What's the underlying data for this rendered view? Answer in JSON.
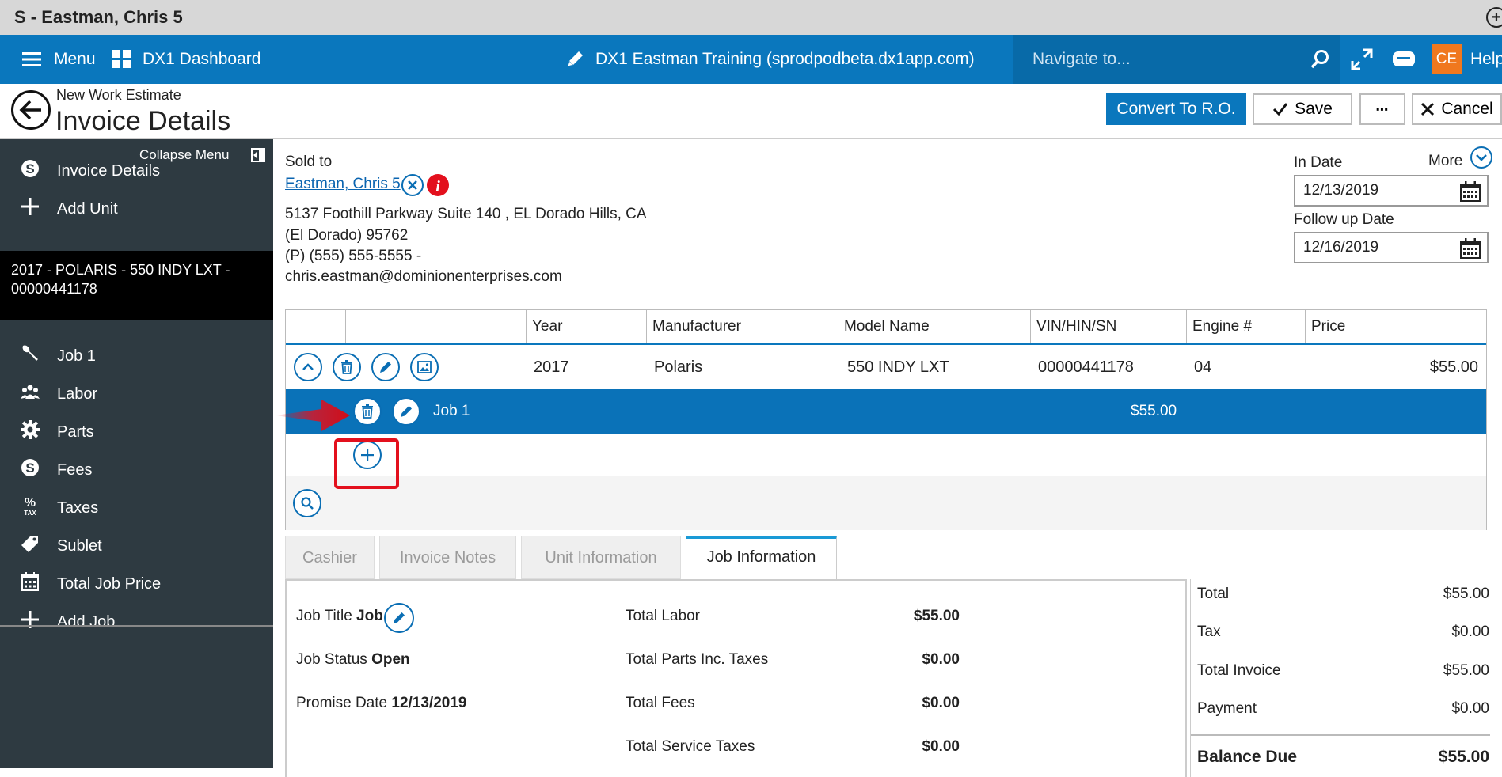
{
  "window": {
    "title": "S - Eastman, Chris 5"
  },
  "topbar": {
    "menu_label": "Menu",
    "dashboard_label": "DX1 Dashboard",
    "site_label": "DX1 Eastman Training (sprodpodbeta.dx1app.com)",
    "navigate_placeholder": "Navigate to...",
    "user_initials": "CE",
    "help_label": "Help",
    "bar_color": "#0a77bd"
  },
  "header": {
    "subtitle": "New Work Estimate",
    "title": "Invoice Details",
    "convert_label": "Convert To R.O.",
    "save_label": "Save",
    "more_label": "▪▪▪",
    "cancel_label": "Cancel"
  },
  "sidebar": {
    "collapse_label": "Collapse Menu",
    "top_items": [
      {
        "label": "Invoice Details",
        "icon": "dollar-circle-icon"
      },
      {
        "label": "Add Unit",
        "icon": "plus-icon"
      }
    ],
    "unit_label": "2017 - POLARIS - 550 INDY LXT - 00000441178",
    "items": [
      {
        "label": "Job 1",
        "icon": "wrench-icon"
      },
      {
        "label": "Labor",
        "icon": "people-icon"
      },
      {
        "label": "Parts",
        "icon": "gear-icon"
      },
      {
        "label": "Fees",
        "icon": "dollar-circle-icon"
      },
      {
        "label": "Taxes",
        "icon": "percent-tax-icon"
      },
      {
        "label": "Sublet",
        "icon": "tag-icon"
      },
      {
        "label": "Total Job Price",
        "icon": "calculator-icon"
      },
      {
        "label": "Add Job",
        "icon": "plus-icon"
      }
    ]
  },
  "customer": {
    "sold_to_label": "Sold to",
    "name": "Eastman, Chris 5",
    "address_line1": "5137 Foothill Parkway Suite 140 , EL Dorado Hills, CA",
    "address_line2": "(El Dorado) 95762",
    "phone": "(P) (555) 555-5555 -",
    "email": "chris.eastman@dominionenterprises.com"
  },
  "dates": {
    "more_label": "More",
    "in_date_label": "In Date",
    "in_date": "12/13/2019",
    "follow_up_label": "Follow up Date",
    "follow_up_date": "12/16/2019"
  },
  "unit_grid": {
    "headers": [
      "Year",
      "Manufacturer",
      "Model Name",
      "VIN/HIN/SN",
      "Engine #",
      "Price"
    ],
    "unit_row": {
      "year": "2017",
      "manufacturer": "Polaris",
      "model": "550 INDY LXT",
      "vin": "00000441178",
      "engine": "04",
      "price": "$55.00"
    },
    "job_row": {
      "name": "Job 1",
      "price": "$55.00"
    }
  },
  "tabs": [
    {
      "label": "Cashier",
      "active": false
    },
    {
      "label": "Invoice Notes",
      "active": false
    },
    {
      "label": "Unit Information",
      "active": false
    },
    {
      "label": "Job Information",
      "active": true
    }
  ],
  "job_info": {
    "title_label": "Job Title",
    "title_value": "Job 1",
    "status_label": "Job Status",
    "status_value": "Open",
    "promise_label": "Promise Date",
    "promise_value": "12/13/2019",
    "totals": [
      {
        "label": "Total Labor",
        "value": "$55.00"
      },
      {
        "label": "Total Parts Inc. Taxes",
        "value": "$0.00"
      },
      {
        "label": "Total Fees",
        "value": "$0.00"
      },
      {
        "label": "Total Service Taxes",
        "value": "$0.00"
      }
    ]
  },
  "summary": {
    "rows": [
      {
        "label": "Total",
        "value": "$55.00"
      },
      {
        "label": "Tax",
        "value": "$0.00"
      },
      {
        "label": "Total Invoice",
        "value": "$55.00"
      },
      {
        "label": "Payment",
        "value": "$0.00"
      }
    ],
    "balance_label": "Balance Due",
    "balance_value": "$55.00"
  },
  "colors": {
    "accent": "#0a77bd",
    "highlight": "#e3101d",
    "sidebar": "#2e3a41"
  }
}
